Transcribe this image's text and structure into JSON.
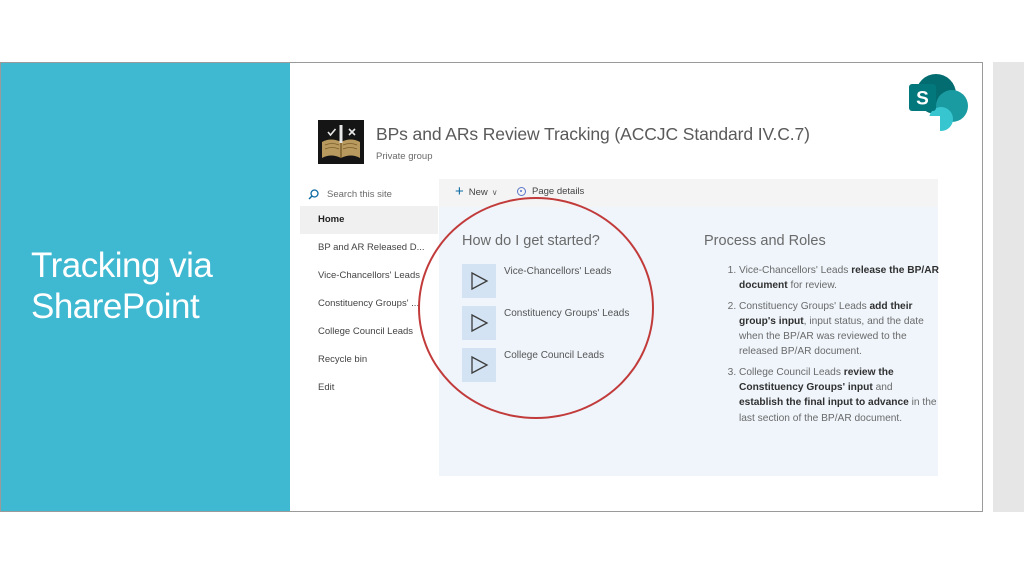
{
  "slide": {
    "title_line1": "Tracking via",
    "title_line2": "SharePoint",
    "accent_color": "#3fb8d1"
  },
  "sharepoint_logo_letter": "S",
  "site": {
    "title": "BPs and ARs Review Tracking (ACCJC Standard IV.C.7)",
    "subtitle": "Private group"
  },
  "search": {
    "placeholder": "Search this site",
    "icon": "search-icon"
  },
  "nav": {
    "items": [
      {
        "label": "Home",
        "active": true
      },
      {
        "label": "BP and AR Released D..."
      },
      {
        "label": "Vice-Chancellors' Leads"
      },
      {
        "label": "Constituency Groups' ..."
      },
      {
        "label": "College Council Leads"
      },
      {
        "label": "Recycle bin"
      },
      {
        "label": "Edit"
      }
    ]
  },
  "commandbar": {
    "new_label": "New",
    "page_details_label": "Page details"
  },
  "get_started": {
    "title": "How do I get started?",
    "items": [
      {
        "label": "Vice-Chancellors' Leads",
        "icon": "play-icon"
      },
      {
        "label": "Constituency Groups' Leads",
        "icon": "play-icon"
      },
      {
        "label": "College Council Leads",
        "icon": "play-icon"
      }
    ]
  },
  "process": {
    "title": "Process and Roles",
    "items": [
      {
        "a": "Vice-Chancellors' Leads ",
        "b": "release the BP/AR document",
        "c": " for review."
      },
      {
        "a": "Constituency Groups' Leads ",
        "b": "add their group's input",
        "c": ", input status, and the date when the BP/AR was reviewed to the released BP/AR document."
      },
      {
        "a": "College Council Leads ",
        "b": "review the Constituency Groups' input",
        "c": " and ",
        "d": "establish the final input to advance",
        "e": " in the last section of the BP/AR document."
      }
    ]
  },
  "highlight_color": "#c23b3b"
}
